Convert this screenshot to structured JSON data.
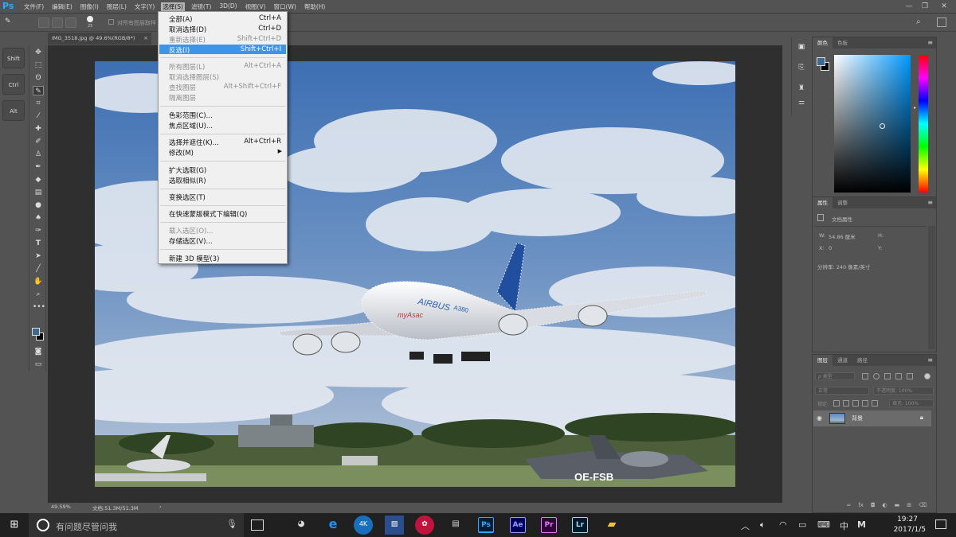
{
  "app": {
    "logo": "Ps"
  },
  "menubar": {
    "items": [
      "文件(F)",
      "编辑(E)",
      "图像(I)",
      "图层(L)",
      "文字(Y)",
      "选择(S)",
      "滤镜(T)",
      "3D(D)",
      "视图(V)",
      "窗口(W)",
      "帮助(H)"
    ],
    "active_index": 5
  },
  "window_controls": {
    "minimize": "—",
    "restore": "❐",
    "close": "✕"
  },
  "options_bar": {
    "brush_size": "25",
    "checkbox_label": "对所有图层取样",
    "search_icon": "search-icon"
  },
  "mod_keys": [
    "Shift",
    "Ctrl",
    "Alt"
  ],
  "document_tab": {
    "title": "IMG_3518.jpg @ 49.6%(RGB/8*)",
    "close": "×"
  },
  "status_bar": {
    "zoom": "49.59%",
    "doc": "文档:51.3M/51.3M",
    "arrow": "›"
  },
  "select_menu": {
    "items": [
      {
        "label": "全部(A)",
        "shortcut": "Ctrl+A",
        "enabled": true
      },
      {
        "label": "取消选择(D)",
        "shortcut": "Ctrl+D",
        "enabled": true
      },
      {
        "label": "重新选择(E)",
        "shortcut": "Shift+Ctrl+D",
        "enabled": false
      },
      {
        "label": "反选(I)",
        "shortcut": "Shift+Ctrl+I",
        "enabled": true,
        "highlighted": true
      },
      {
        "label": "所有图层(L)",
        "shortcut": "Alt+Ctrl+A",
        "enabled": false
      },
      {
        "label": "取消选择图层(S)",
        "shortcut": "",
        "enabled": false
      },
      {
        "label": "查找图层",
        "shortcut": "Alt+Shift+Ctrl+F",
        "enabled": false
      },
      {
        "label": "隔离图层",
        "shortcut": "",
        "enabled": false
      },
      {
        "label": "色彩范围(C)...",
        "shortcut": "",
        "enabled": true
      },
      {
        "label": "焦点区域(U)...",
        "shortcut": "",
        "enabled": true
      },
      {
        "label": "选择并遮住(K)...",
        "shortcut": "Alt+Ctrl+R",
        "enabled": true
      },
      {
        "label": "修改(M)",
        "shortcut": "",
        "enabled": true,
        "submenu": true
      },
      {
        "label": "扩大选取(G)",
        "shortcut": "",
        "enabled": true
      },
      {
        "label": "选取相似(R)",
        "shortcut": "",
        "enabled": true
      },
      {
        "label": "变换选区(T)",
        "shortcut": "",
        "enabled": true
      },
      {
        "label": "在快速蒙版模式下编辑(Q)",
        "shortcut": "",
        "enabled": true
      },
      {
        "label": "载入选区(O)...",
        "shortcut": "",
        "enabled": false
      },
      {
        "label": "存储选区(V)...",
        "shortcut": "",
        "enabled": true
      },
      {
        "label": "新建 3D 模型(3)",
        "shortcut": "",
        "enabled": true
      }
    ]
  },
  "color_panel": {
    "tabs": [
      "颜色",
      "色板"
    ],
    "foreground": "#3d6a8e",
    "background": "#000000"
  },
  "properties_panel": {
    "tabs": [
      "属性",
      "调整"
    ],
    "heading": "文档属性",
    "w_label": "W:",
    "w_value": "54.86 厘米",
    "h_label": "H:",
    "x_label": "X:",
    "x_value": "0",
    "y_label": "Y:",
    "resolution": "分辨率: 240 像素/英寸"
  },
  "layers_panel": {
    "tabs": [
      "图层",
      "通道",
      "路径"
    ],
    "filter": "ρ 类型",
    "blend_mode": "正常",
    "opacity": "不透明度: 100%",
    "lock_label": "锁定:",
    "fill": "填充: 100%",
    "layer_name": "背景"
  },
  "photo_text": {
    "airbus": "AIRBUS",
    "model": "A380",
    "myasac": "myAsac",
    "registration": "OE-FSB"
  },
  "taskbar": {
    "search_placeholder": "有问题尽管问我",
    "apps": [
      "Ps",
      "Ae",
      "Pr",
      "Lr"
    ],
    "ime": "中",
    "ime2": "M",
    "time": "19:27",
    "date": "2017/1/5"
  },
  "colors": {
    "accent": "#3e95e8",
    "ps_blue": "#31a8ff",
    "ae": "#9999ff",
    "pr": "#9999ff",
    "lr": "#add5ec"
  }
}
